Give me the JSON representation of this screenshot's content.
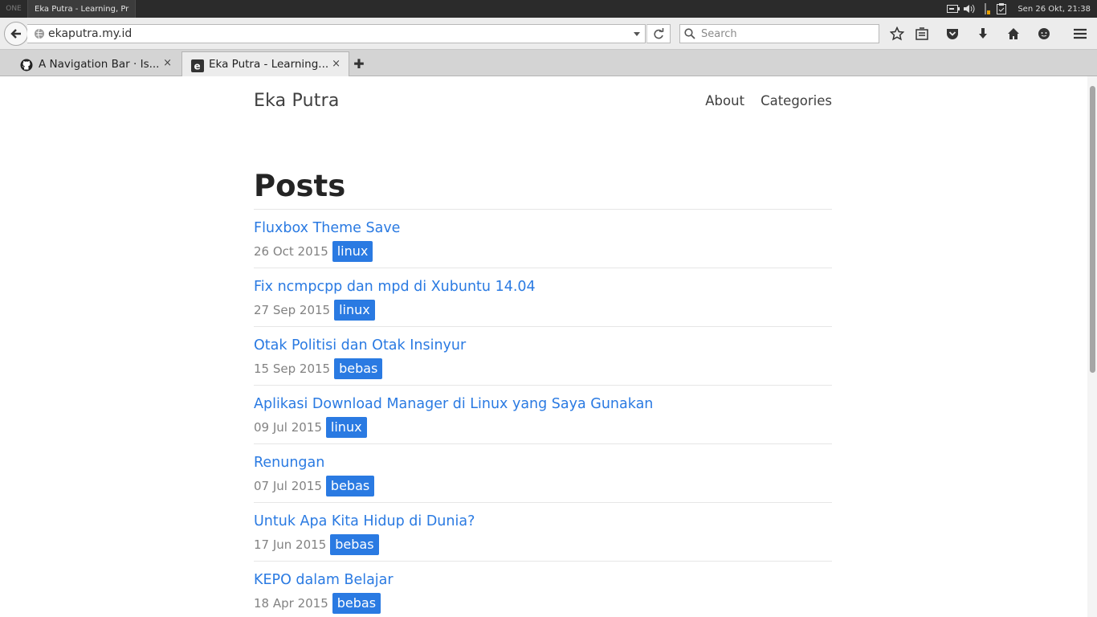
{
  "system_panel": {
    "workspace": "ONE",
    "active_task": "Eka Putra - Learning, Pr",
    "clock": "Sen 26 Okt, 21:38"
  },
  "toolbar": {
    "url": "ekaputra.my.id",
    "search_placeholder": "Search"
  },
  "tabs": [
    {
      "title": "A Navigation Bar · Is...",
      "close": "×"
    },
    {
      "title": "Eka Putra - Learning...",
      "close": "×"
    }
  ],
  "new_tab_label": "✚",
  "site": {
    "title": "Eka Putra",
    "nav": [
      "About",
      "Categories"
    ],
    "heading": "Posts"
  },
  "posts": [
    {
      "title": "Fluxbox Theme Save",
      "date": "26 Oct 2015",
      "tag": "linux"
    },
    {
      "title": "Fix ncmpcpp dan mpd di Xubuntu 14.04",
      "date": "27 Sep 2015",
      "tag": "linux"
    },
    {
      "title": "Otak Politisi dan Otak Insinyur",
      "date": "15 Sep 2015",
      "tag": "bebas"
    },
    {
      "title": "Aplikasi Download Manager di Linux yang Saya Gunakan",
      "date": "09 Jul 2015",
      "tag": "linux"
    },
    {
      "title": "Renungan",
      "date": "07 Jul 2015",
      "tag": "bebas"
    },
    {
      "title": "Untuk Apa Kita Hidup di Dunia?",
      "date": "17 Jun 2015",
      "tag": "bebas"
    },
    {
      "title": "KEPO dalam Belajar",
      "date": "18 Apr 2015",
      "tag": "bebas"
    }
  ],
  "colors": {
    "link": "#2a7ae2",
    "tag_bg": "#2a7ae2",
    "meta": "#828282"
  }
}
